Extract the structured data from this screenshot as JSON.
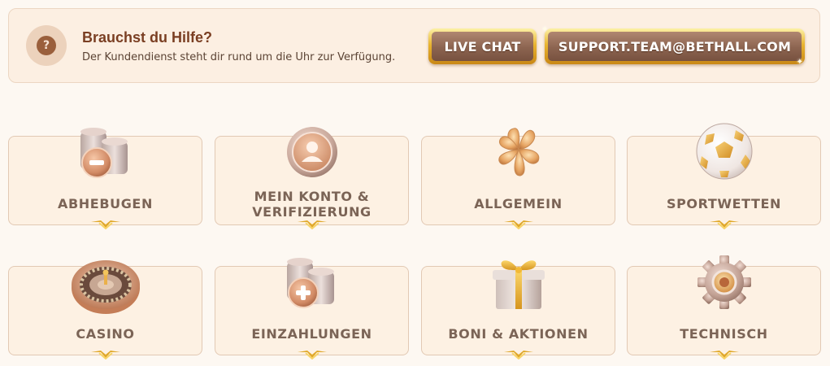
{
  "help": {
    "icon": "question-icon",
    "title": "Brauchst du Hilfe?",
    "subtitle": "Der Kundendienst steht dir rund um die Uhr zur Verfügung.",
    "live_chat_label": "LIVE CHAT",
    "email_label": "SUPPORT.TEAM@BETHALL.COM"
  },
  "categories": [
    {
      "label": "ABHEBUGEN",
      "icon": "coin-stack-minus-icon"
    },
    {
      "label": "MEIN KONTO & VERIFIZIERUNG",
      "icon": "user-coin-icon"
    },
    {
      "label": "ALLGEMEIN",
      "icon": "four-leaf-clover-icon"
    },
    {
      "label": "SPORTWETTEN",
      "icon": "soccer-ball-icon"
    },
    {
      "label": "CASINO",
      "icon": "roulette-wheel-icon"
    },
    {
      "label": "EINZAHLUNGEN",
      "icon": "coin-stack-plus-icon"
    },
    {
      "label": "BONI & AKTIONEN",
      "icon": "gift-box-icon"
    },
    {
      "label": "TECHNISCH",
      "icon": "gear-icon"
    }
  ],
  "colors": {
    "background": "#fdf8f2",
    "card_background": "#fdf1e3",
    "title": "#7a3e22",
    "label": "#7b6456",
    "gold": "#e9b431",
    "button_face": "#8c6450"
  }
}
